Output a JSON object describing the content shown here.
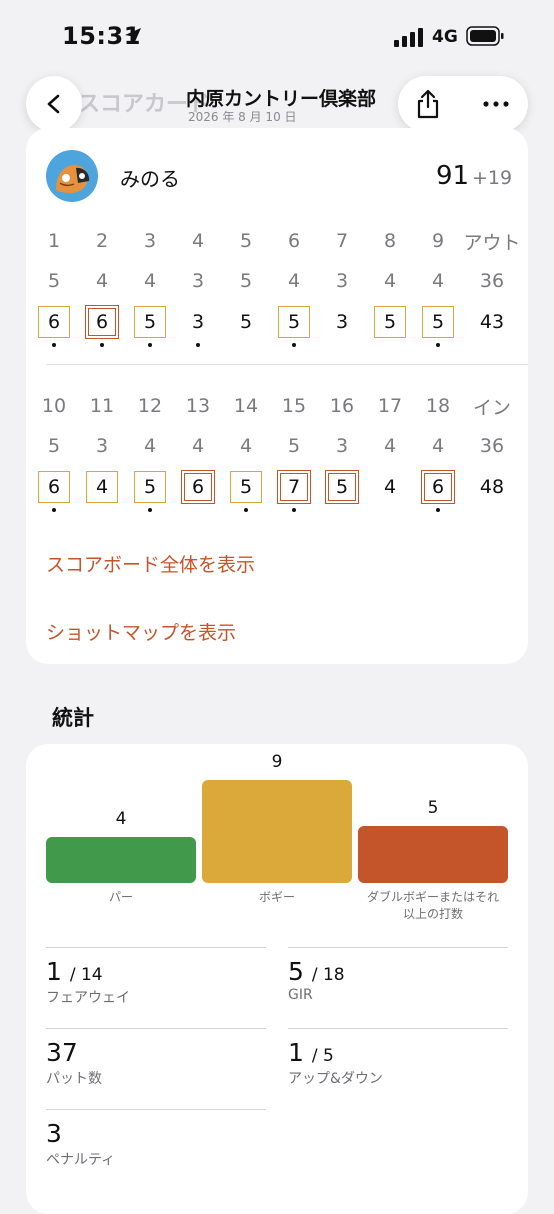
{
  "status_bar": {
    "time": "15:31",
    "network": "4G"
  },
  "nav": {
    "back_title": "スコアカード",
    "title": "内原カントリー倶楽部",
    "date": "2026 年 8 月 10 日"
  },
  "player": {
    "name": "みのる",
    "total": "91",
    "to_par": "+19"
  },
  "scorecard": {
    "out": {
      "holes": [
        "1",
        "2",
        "3",
        "4",
        "5",
        "6",
        "7",
        "8",
        "9"
      ],
      "total_label": "アウト",
      "pars": [
        "5",
        "4",
        "4",
        "3",
        "5",
        "4",
        "3",
        "4",
        "4"
      ],
      "par_total": "36",
      "scores": [
        "6",
        "6",
        "5",
        "3",
        "5",
        "5",
        "3",
        "5",
        "5"
      ],
      "score_total": "43"
    },
    "in": {
      "holes": [
        "10",
        "11",
        "12",
        "13",
        "14",
        "15",
        "16",
        "17",
        "18"
      ],
      "total_label": "イン",
      "pars": [
        "5",
        "3",
        "4",
        "4",
        "4",
        "5",
        "3",
        "4",
        "4"
      ],
      "par_total": "36",
      "scores": [
        "6",
        "4",
        "5",
        "6",
        "5",
        "7",
        "5",
        "4",
        "6"
      ],
      "score_total": "48"
    }
  },
  "links": {
    "scoreboard": "スコアボード全体を表示",
    "shotmap": "ショットマップを表示"
  },
  "stats": {
    "title": "統計",
    "chart_data": {
      "type": "bar",
      "categories": [
        "パー",
        "ボギー",
        "ダブルボギーまたはそれ以上の打数"
      ],
      "values": [
        4,
        9,
        5
      ],
      "colors": [
        "#419a4b",
        "#daa93a",
        "#c4552b"
      ],
      "value_labels": [
        "4",
        "9",
        "5"
      ],
      "label_lines": [
        [
          "パー"
        ],
        [
          "ボギー"
        ],
        [
          "ダブルボギーまたはそれ",
          "以上の打数"
        ]
      ]
    },
    "fairway": {
      "value": "1",
      "of": "/ 14",
      "label": "フェアウェイ"
    },
    "gir": {
      "value": "5",
      "of": "/ 18",
      "label": "GIR"
    },
    "putts": {
      "value": "37",
      "label": "パット数"
    },
    "up_down": {
      "value": "1",
      "of": "/ 5",
      "label": "アップ&ダウン"
    },
    "penalty": {
      "value": "3",
      "label": "ペナルティ"
    }
  },
  "colors": {
    "accent": "#c4552b",
    "bogey": "#dba63a",
    "double_bogey": "#c4552b"
  }
}
